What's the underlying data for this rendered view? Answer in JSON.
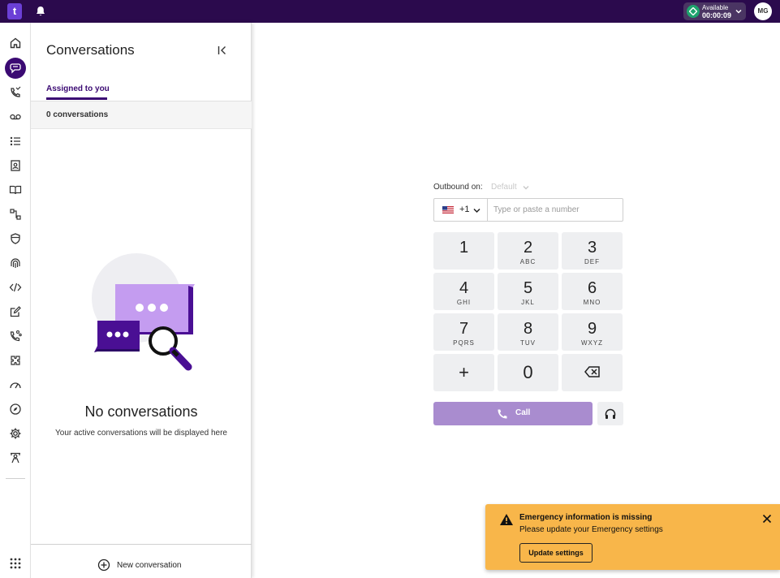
{
  "topbar": {
    "logo_glyph": "t",
    "status_label": "Available",
    "status_timer": "00:00:09",
    "avatar_initials": "MG"
  },
  "rail": {
    "items": [
      "home-icon",
      "conversations-icon",
      "missed-calls-icon",
      "voicemail-icon",
      "queue-list-icon",
      "contacts-icon",
      "knowledge-book-icon",
      "workflow-icon",
      "shield-icon",
      "fingerprint-icon",
      "code-icon",
      "edit-icon",
      "call-routing-icon",
      "integrations-icon",
      "dashboard-gauge-icon",
      "compass-icon",
      "settings-gear-icon",
      "training-icon"
    ],
    "apps_icon": "grid-icon"
  },
  "panel": {
    "title": "Conversations",
    "tab_assigned": "Assigned to you",
    "count_text": "0 conversations",
    "empty_title": "No conversations",
    "empty_subtitle": "Your active conversations will be displayed here",
    "new_conversation": "New conversation"
  },
  "dialer": {
    "outbound_label": "Outbound on:",
    "outbound_value": "Default",
    "dial_code": "+1",
    "phone_placeholder": "Type or paste a number",
    "keys": [
      {
        "digit": "1",
        "letters": ""
      },
      {
        "digit": "2",
        "letters": "ABC"
      },
      {
        "digit": "3",
        "letters": "DEF"
      },
      {
        "digit": "4",
        "letters": "GHI"
      },
      {
        "digit": "5",
        "letters": "JKL"
      },
      {
        "digit": "6",
        "letters": "MNO"
      },
      {
        "digit": "7",
        "letters": "PQRS"
      },
      {
        "digit": "8",
        "letters": "TUV"
      },
      {
        "digit": "9",
        "letters": "WXYZ"
      }
    ],
    "plus_key": "+",
    "zero_key": "0",
    "call_label": "Call"
  },
  "toast": {
    "title": "Emergency information is missing",
    "message": "Please update your Emergency settings",
    "button": "Update settings"
  },
  "colors": {
    "topbar_bg": "#2b0a4d",
    "brand_purple": "#3b0a73",
    "call_button": "#a98ccf",
    "toast_bg": "#f8b64a",
    "status_green": "#1ea36e"
  }
}
